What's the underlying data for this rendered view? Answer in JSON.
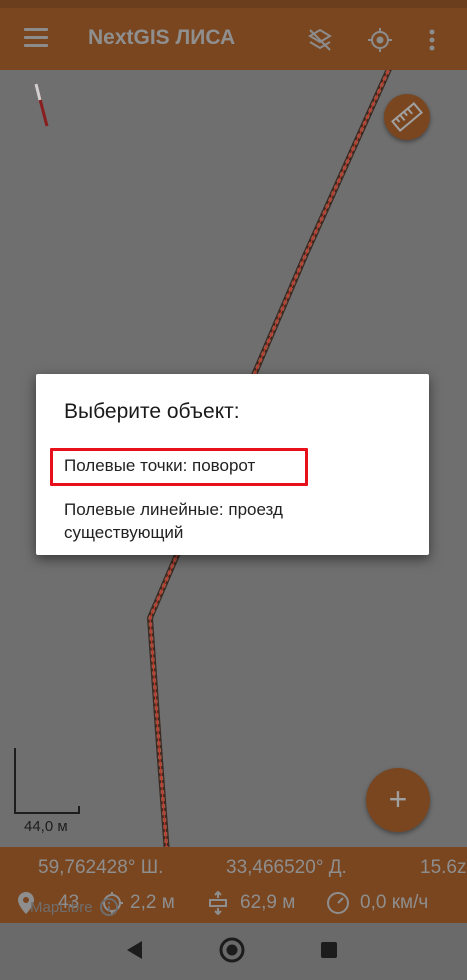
{
  "app": {
    "title": "NextGIS ЛИСА"
  },
  "map": {
    "scale_label": "44,0 м"
  },
  "info": {
    "latitude": "59,762428° Ш.",
    "longitude": "33,466520° Д.",
    "zoom": "15.6z",
    "satellites": "43",
    "accuracy": "2,2 м",
    "altitude": "62,9 м",
    "speed": "0,0 км/ч",
    "attribution": "MapLibre"
  },
  "dialog": {
    "title": "Выберите объект:",
    "options": [
      {
        "label": "Полевые точки: поворот"
      },
      {
        "label": "Полевые линейные: проезд существующий"
      }
    ]
  },
  "colors": {
    "accent": "#7a4620",
    "highlight": "#e8101a"
  }
}
